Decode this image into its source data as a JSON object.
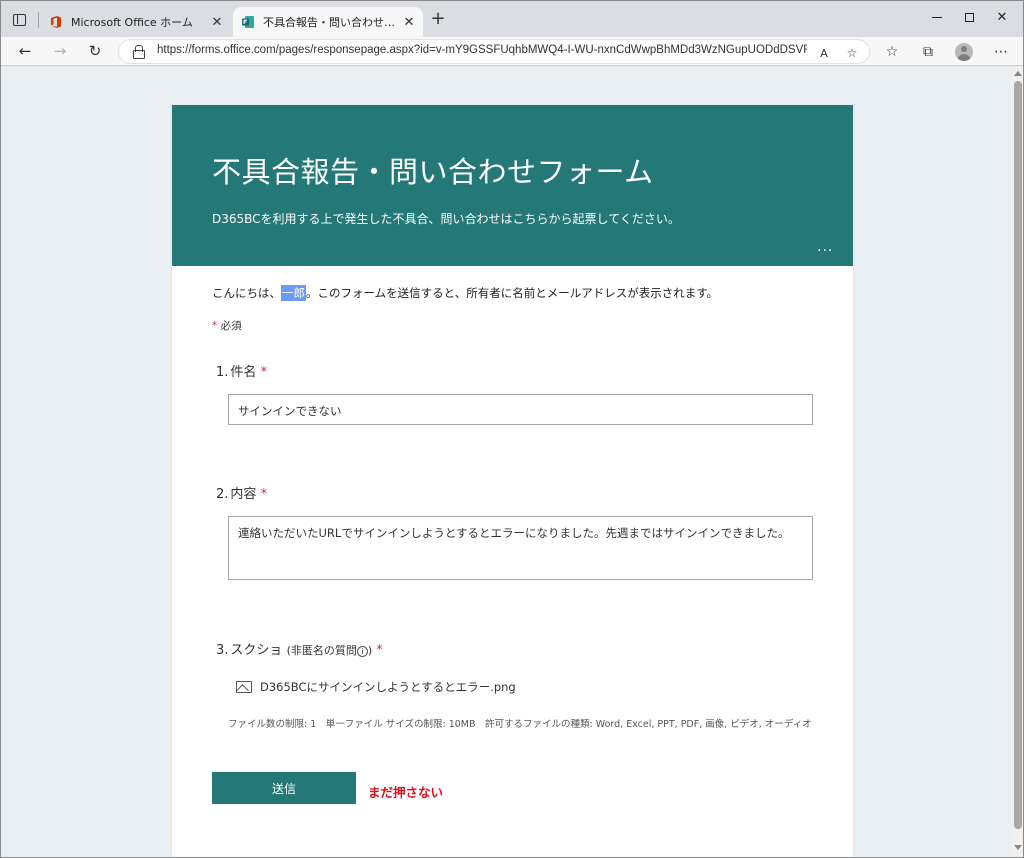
{
  "browser": {
    "tabs": [
      {
        "label": "Microsoft Office ホーム",
        "active": false
      },
      {
        "label": "不具合報告・問い合わせフォーム",
        "active": true
      }
    ],
    "url": "https://forms.office.com/pages/responsepage.aspx?id=v-mY9GSSFUqhbMWQ4-I-WU-nxnCdWwpBhMDd3WzNGupUODdDSVRLR...",
    "read_aloud_label": "A"
  },
  "form": {
    "title": "不具合報告・問い合わせフォーム",
    "description": "D365BCを利用する上で発生した不具合、問い合わせはこちらから起票してください。",
    "more": "···",
    "greeting_prefix": "こんにちは、",
    "user_name": "一郎",
    "greeting_suffix": "。このフォームを送信すると、所有者に名前とメールアドレスが表示されます。",
    "required_mark": "*",
    "required_label": "必須",
    "questions": [
      {
        "number": "1.",
        "label": "件名",
        "value": "サインインできない"
      },
      {
        "number": "2.",
        "label": "内容",
        "value": "連絡いただいたURLでサインインしようとするとエラーになりました。先週まではサインインできました。"
      },
      {
        "number": "3.",
        "label": "スクショ",
        "sub": "(非匿名の質問",
        "info": "i",
        "sub_close": ")",
        "file": "D365BCにサインインしようとするとエラー.png"
      }
    ],
    "file_limits": "ファイル数の制限: 1　単一ファイル サイズの制限: 10MB　許可するファイルの種類: Word, Excel, PPT, PDF, 画像, ビデオ, オーディオ",
    "submit_label": "送信",
    "annotation": "まだ押さない"
  },
  "colors": {
    "theme": "#247878",
    "required": "#c4314b",
    "annotation": "#e0101e",
    "highlight": "#6b9cf5"
  }
}
